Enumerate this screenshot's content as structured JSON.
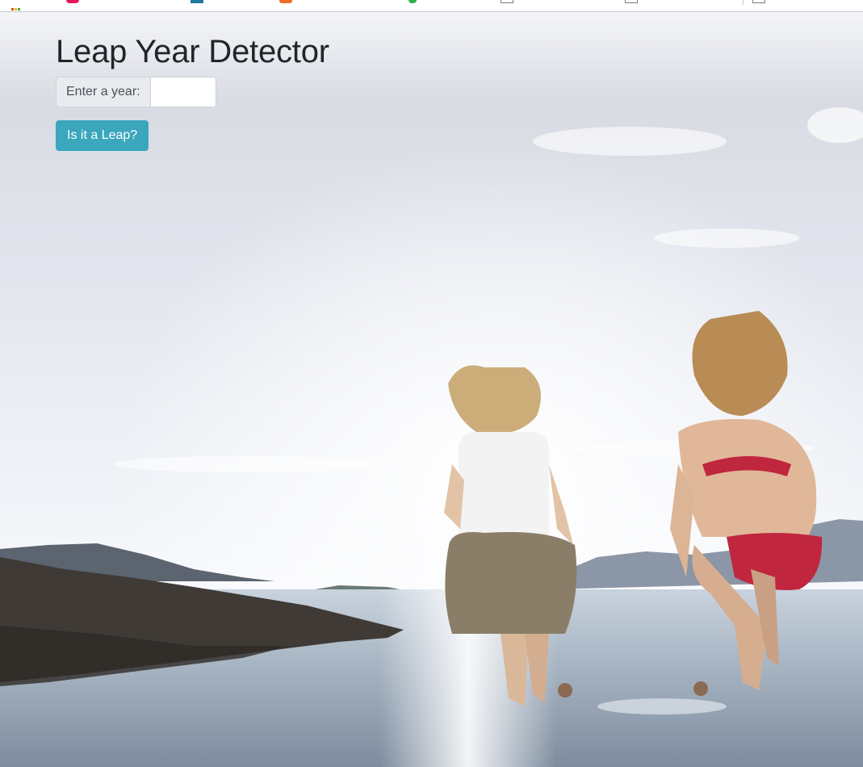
{
  "page": {
    "title": "Leap Year Detector"
  },
  "form": {
    "label": "Enter a year:",
    "input_value": "",
    "input_placeholder": "",
    "button_label": "Is it a Leap?"
  },
  "colors": {
    "button": "#3aa7bd",
    "title": "#212529",
    "label_bg": "#e9ecef"
  },
  "background": {
    "description_icon": "beach-photo"
  }
}
